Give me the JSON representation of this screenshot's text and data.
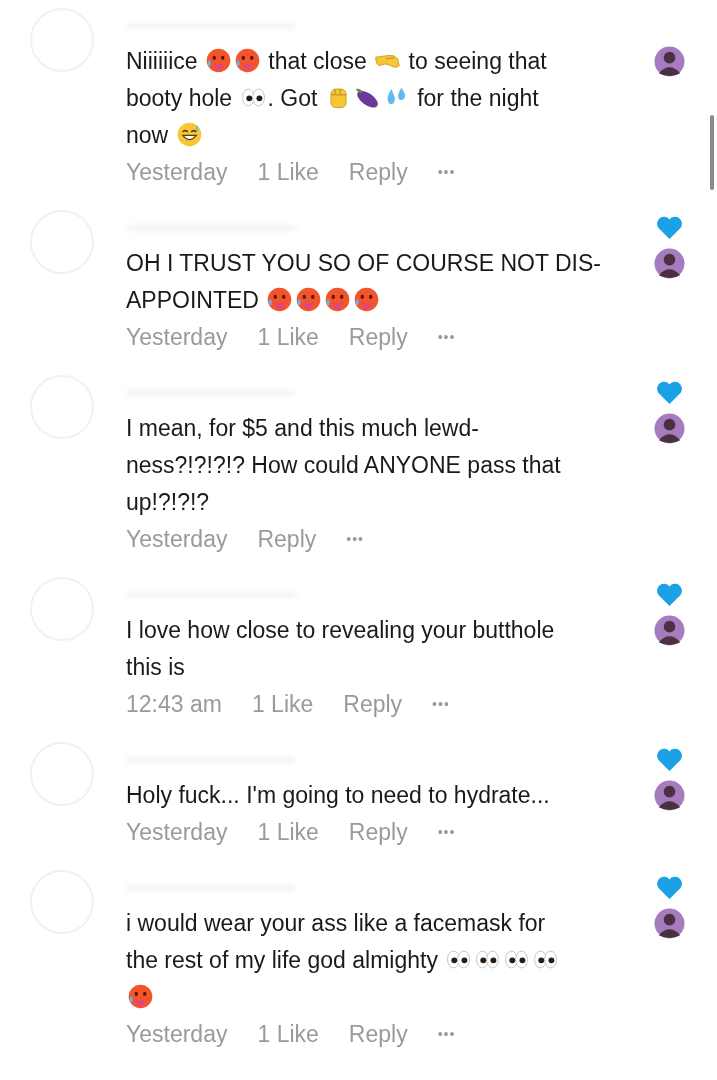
{
  "comments": [
    {
      "creator_liked": false,
      "lines": [
        [
          {
            "kind": "text",
            "text": "Niiiiiice "
          },
          {
            "kind": "hot-face"
          },
          {
            "kind": "hot-face"
          },
          {
            "kind": "text",
            "text": " that close "
          },
          {
            "kind": "pinch"
          },
          {
            "kind": "text",
            "text": " to seeing that"
          }
        ],
        [
          {
            "kind": "text",
            "text": "booty hole "
          },
          {
            "kind": "eyes"
          },
          {
            "kind": "text",
            "text": ". Got "
          },
          {
            "kind": "fist"
          },
          {
            "kind": "eggplant"
          },
          {
            "kind": "droplets"
          },
          {
            "kind": "text",
            "text": " for the night"
          }
        ],
        [
          {
            "kind": "text",
            "text": "now "
          },
          {
            "kind": "grin-sweat"
          }
        ]
      ],
      "time": "Yesterday",
      "likes": "1 Like",
      "reply": "Reply",
      "more": "•••"
    },
    {
      "creator_liked": true,
      "lines": [
        [
          {
            "kind": "text",
            "text": "OH I TRUST YOU SO OF COURSE NOT DIS-"
          }
        ],
        [
          {
            "kind": "text",
            "text": "APPOINTED "
          },
          {
            "kind": "hot-face"
          },
          {
            "kind": "hot-face"
          },
          {
            "kind": "hot-face"
          },
          {
            "kind": "hot-face"
          }
        ]
      ],
      "time": "Yesterday",
      "likes": "1 Like",
      "reply": "Reply",
      "more": "•••"
    },
    {
      "creator_liked": true,
      "lines": [
        [
          {
            "kind": "text",
            "text": "I mean, for $5 and this much lewd-"
          }
        ],
        [
          {
            "kind": "text",
            "text": "ness?!?!?!? How could ANYONE pass that"
          }
        ],
        [
          {
            "kind": "text",
            "text": "up!?!?!?"
          }
        ]
      ],
      "time": "Yesterday",
      "reply": "Reply",
      "more": "•••"
    },
    {
      "creator_liked": true,
      "lines": [
        [
          {
            "kind": "text",
            "text": "I love how close to revealing your butthole"
          }
        ],
        [
          {
            "kind": "text",
            "text": "this is"
          }
        ]
      ],
      "time": "12:43 am",
      "likes": "1 Like",
      "reply": "Reply",
      "more": "•••"
    },
    {
      "creator_liked": true,
      "lines": [
        [
          {
            "kind": "text",
            "text": "Holy fuck... I'm going to need to hydrate..."
          }
        ]
      ],
      "time": "Yesterday",
      "likes": "1 Like",
      "reply": "Reply",
      "more": "•••"
    },
    {
      "creator_liked": true,
      "lines": [
        [
          {
            "kind": "text",
            "text": "i would wear your ass like a facemask for"
          }
        ],
        [
          {
            "kind": "text",
            "text": "the rest of my life god almighty "
          },
          {
            "kind": "eyes"
          },
          {
            "kind": "eyes"
          },
          {
            "kind": "eyes"
          },
          {
            "kind": "eyes"
          }
        ],
        [
          {
            "kind": "hot-face"
          }
        ]
      ],
      "time": "Yesterday",
      "likes": "1 Like",
      "reply": "Reply",
      "more": "•••"
    }
  ]
}
